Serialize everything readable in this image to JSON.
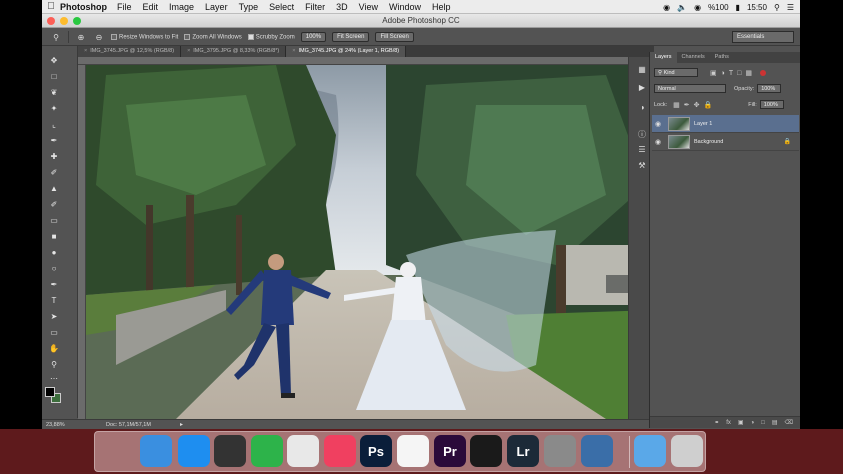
{
  "menubar": {
    "app": "Photoshop",
    "items": [
      "File",
      "Edit",
      "Image",
      "Layer",
      "Type",
      "Select",
      "Filter",
      "3D",
      "View",
      "Window",
      "Help"
    ],
    "battery": "%100",
    "clock": "15:50"
  },
  "window": {
    "title": "Adobe Photoshop CC"
  },
  "options": {
    "resize_windows": "Resize Windows to Fit",
    "zoom_all": "Zoom All Windows",
    "scrubby_zoom": "Scrubby Zoom",
    "zoom_100": "100%",
    "fit_screen": "Fit Screen",
    "fill_screen": "Fill Screen",
    "workspace": "Essentials"
  },
  "tabs": [
    {
      "label": "IMG_3745.JPG @ 12,5% (RGB/8)"
    },
    {
      "label": "IMG_3795.JPG @ 8,33% (RGB/8*)"
    },
    {
      "label": "IMG_3745.JPG @ 24% (Layer 1, RGB/8)"
    }
  ],
  "status": {
    "zoom": "23,88%",
    "doc": "Doc: 57,1M/57,1M"
  },
  "layers_panel": {
    "tabs": [
      "Layers",
      "Channels",
      "Paths"
    ],
    "kind": "Kind",
    "blend_mode": "Normal",
    "opacity_label": "Opacity:",
    "opacity_value": "100%",
    "lock_label": "Lock:",
    "fill_label": "Fill:",
    "fill_value": "100%",
    "layers": [
      {
        "name": "Layer 1",
        "active": true
      },
      {
        "name": "Background",
        "active": false
      }
    ]
  },
  "dock": {
    "apps": [
      {
        "name": "Finder",
        "label": "",
        "color": "#3a8fe0"
      },
      {
        "name": "App Store",
        "label": "",
        "color": "#1e8ef0"
      },
      {
        "name": "Launchpad",
        "label": "",
        "color": "#333333"
      },
      {
        "name": "Evernote",
        "label": "",
        "color": "#2db34a"
      },
      {
        "name": "Chrome",
        "label": "",
        "color": "#e8e8e8"
      },
      {
        "name": "iTunes",
        "label": "",
        "color": "#f04060"
      },
      {
        "name": "Photoshop",
        "label": "Ps",
        "color": "#0a1e3a"
      },
      {
        "name": "Photos",
        "label": "",
        "color": "#f5f5f5"
      },
      {
        "name": "Premiere",
        "label": "Pr",
        "color": "#2a0a3a"
      },
      {
        "name": "Final Cut Pro",
        "label": "",
        "color": "#1a1a1a"
      },
      {
        "name": "Lightroom",
        "label": "Lr",
        "color": "#1c2a38"
      },
      {
        "name": "System Preferences",
        "label": "",
        "color": "#8a8a8a"
      },
      {
        "name": "QuickTime",
        "label": "",
        "color": "#3a6ea8"
      },
      {
        "name": "Folder",
        "label": "",
        "color": "#5aa8e8"
      },
      {
        "name": "Trash",
        "label": "",
        "color": "#cfcfcf"
      }
    ]
  }
}
